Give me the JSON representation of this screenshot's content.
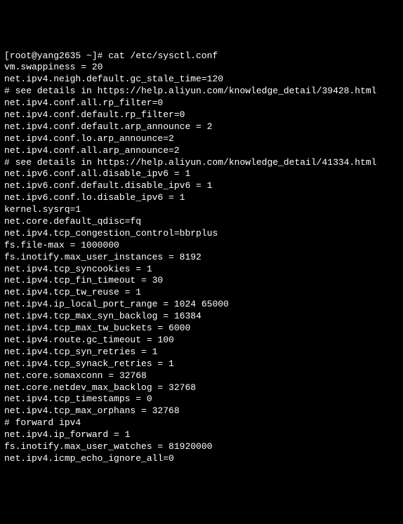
{
  "terminal": {
    "prompt": "[root@yang2635 ~]# ",
    "command": "cat /etc/sysctl.conf",
    "lines": [
      "vm.swappiness = 20",
      "net.ipv4.neigh.default.gc_stale_time=120",
      "",
      "# see details in https://help.aliyun.com/knowledge_detail/39428.html",
      "net.ipv4.conf.all.rp_filter=0",
      "net.ipv4.conf.default.rp_filter=0",
      "net.ipv4.conf.default.arp_announce = 2",
      "net.ipv4.conf.lo.arp_announce=2",
      "net.ipv4.conf.all.arp_announce=2",
      "",
      "# see details in https://help.aliyun.com/knowledge_detail/41334.html",
      "",
      "net.ipv6.conf.all.disable_ipv6 = 1",
      "net.ipv6.conf.default.disable_ipv6 = 1",
      "net.ipv6.conf.lo.disable_ipv6 = 1",
      "",
      "kernel.sysrq=1",
      "net.core.default_qdisc=fq",
      "net.ipv4.tcp_congestion_control=bbrplus",
      "fs.file-max = 1000000",
      "fs.inotify.max_user_instances = 8192",
      "net.ipv4.tcp_syncookies = 1",
      "net.ipv4.tcp_fin_timeout = 30",
      "net.ipv4.tcp_tw_reuse = 1",
      "net.ipv4.ip_local_port_range = 1024 65000",
      "net.ipv4.tcp_max_syn_backlog = 16384",
      "net.ipv4.tcp_max_tw_buckets = 6000",
      "net.ipv4.route.gc_timeout = 100",
      "net.ipv4.tcp_syn_retries = 1",
      "net.ipv4.tcp_synack_retries = 1",
      "net.core.somaxconn = 32768",
      "net.core.netdev_max_backlog = 32768",
      "net.ipv4.tcp_timestamps = 0",
      "net.ipv4.tcp_max_orphans = 32768",
      "# forward ipv4",
      "net.ipv4.ip_forward = 1",
      "fs.inotify.max_user_watches = 81920000",
      "",
      "net.ipv4.icmp_echo_ignore_all=0"
    ]
  }
}
